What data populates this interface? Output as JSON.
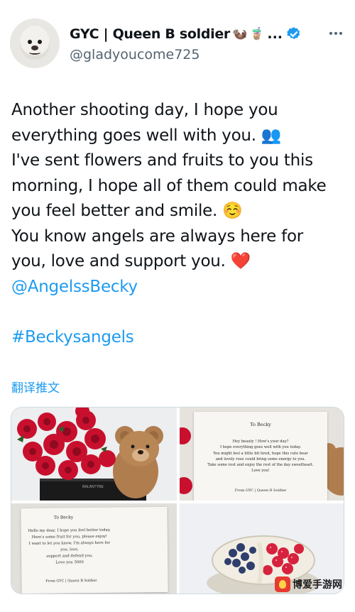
{
  "author": {
    "display_name": "GYC | Queen B soldier",
    "name_emojis": [
      "🦦",
      "🧋"
    ],
    "truncation": "...",
    "handle": "@gladyoucome725",
    "avatar_icon": "otter-avatar-icon",
    "verified_icon": "verified-badge-icon",
    "verified_color": "#1d9bf0"
  },
  "tweet": {
    "lines": [
      "Another shooting day, I hope you",
      "everything goes well with you. 👥",
      "I've sent flowers and fruits to you this",
      "morning, I hope all of them could make",
      "you feel better and smile. ☺️",
      "You know angels are always here for",
      "you, love and support you. ❤️"
    ],
    "mention": "@AngelssBecky",
    "hashtag": "#Beckysangels",
    "link_color": "#1d9bf0"
  },
  "translate_label": "翻译推文",
  "media": {
    "card1": {
      "title": "To Becky",
      "body": [
        "Hey beauty ! How's your day?",
        "I hope everything goes well with you today.",
        "You might feel a little bit tired, hope this cute bear",
        "and lovely rose could bring some energy to you.",
        "Take some rest and enjoy the rest of the day sweetheart.",
        "Love you!"
      ],
      "signature": "From  GYC | Queen B Soldier"
    },
    "card2": {
      "title": "To Becky",
      "body": [
        "Hello my dear, I hope you feel better today.",
        "Here's some fruit for you, please enjoy!",
        "I want to let you know, I'm always here for you, love,",
        "support and defend you.",
        "Love you 3000"
      ],
      "signature": "From  GYC | Queen B Soldier"
    },
    "box_label": "BALANTYNE"
  },
  "watermark": {
    "text": "博爱手游网"
  }
}
